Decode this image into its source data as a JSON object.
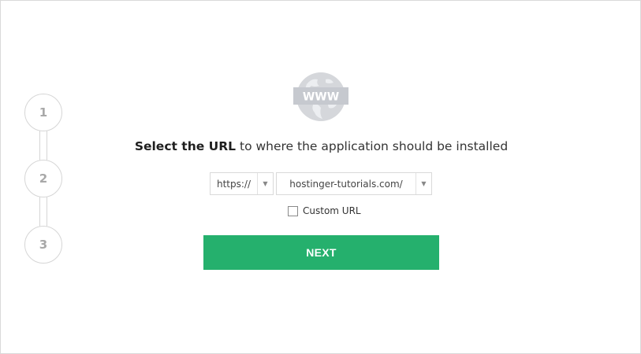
{
  "stepper": {
    "steps": [
      {
        "number": "1"
      },
      {
        "number": "2"
      },
      {
        "number": "3"
      }
    ]
  },
  "icons": {
    "globe": "www-globe-icon",
    "globe_label": "WWW",
    "dropdown": "triangle-down"
  },
  "heading": {
    "strong": "Select the URL",
    "rest": "to where the application should be installed"
  },
  "protocol_select": {
    "value": "https://"
  },
  "domain_select": {
    "value": "hostinger-tutorials.com/"
  },
  "custom_url": {
    "label": "Custom URL",
    "checked": false
  },
  "next_button": {
    "label": "NEXT"
  },
  "colors": {
    "accent": "#25b06d",
    "stepper_border": "#d6d6d6",
    "globe": "#d5d7db"
  }
}
